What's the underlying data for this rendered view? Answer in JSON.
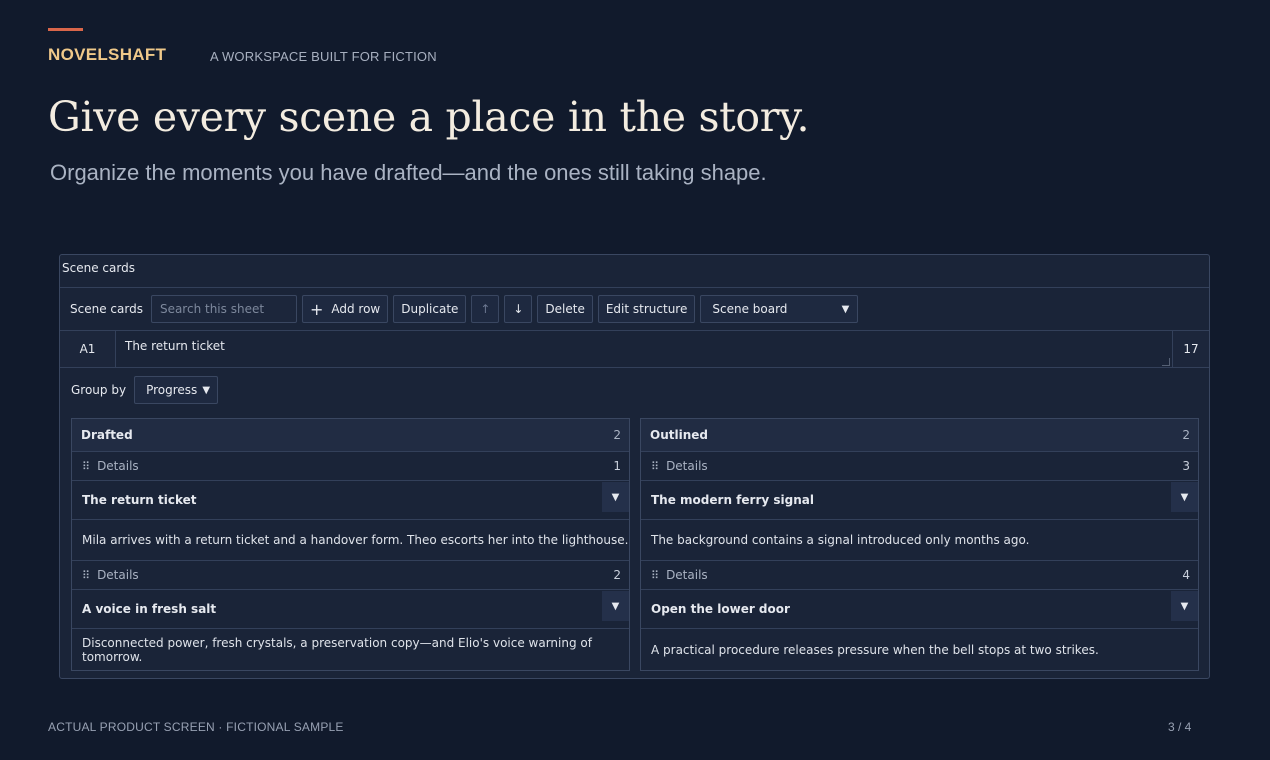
{
  "header": {
    "brand": "NOVELSHAFT",
    "tagline": "A WORKSPACE BUILT FOR FICTION",
    "headline": "Give every scene a place in the story.",
    "subhead": "Organize the moments you have drafted—and the ones still taking shape."
  },
  "panel": {
    "title": "Scene cards",
    "toolbar": {
      "label": "Scene cards",
      "search_placeholder": "Search this sheet",
      "add_row": "Add row",
      "add_icon": "+",
      "duplicate": "Duplicate",
      "move_up_icon": "↑",
      "move_down_icon": "↓",
      "delete": "Delete",
      "edit_structure": "Edit structure",
      "view_select": "Scene board"
    },
    "formula": {
      "cell_ref": "A1",
      "value": "The return ticket",
      "char_count": "17"
    },
    "group_by": {
      "label": "Group by",
      "value": "Progress"
    },
    "columns": [
      {
        "title": "Drafted",
        "count": "2",
        "cards": [
          {
            "meta": "Details",
            "number": "1",
            "title": "The return ticket",
            "body": "Mila arrives with a return ticket and a handover form. Theo escorts her into the lighthouse."
          },
          {
            "meta": "Details",
            "number": "2",
            "title": "A voice in fresh salt",
            "body": "Disconnected power, fresh crystals, a preservation copy—and Elio's voice warning of tomorrow."
          }
        ]
      },
      {
        "title": "Outlined",
        "count": "2",
        "cards": [
          {
            "meta": "Details",
            "number": "3",
            "title": "The modern ferry signal",
            "body": "The background contains a signal introduced only months ago."
          },
          {
            "meta": "Details",
            "number": "4",
            "title": "Open the lower door",
            "body": "A practical procedure releases pressure when the bell stops at two strikes."
          }
        ]
      }
    ]
  },
  "footer": {
    "left": "ACTUAL PRODUCT SCREEN · FICTIONAL SAMPLE",
    "right": "3 / 4"
  },
  "icons": {
    "chevron": "chevron-down-icon",
    "grip": "drag-handle-icon"
  },
  "colors": {
    "background": "#111a2c",
    "accent": "#d9664a",
    "brand": "#f0c98a"
  }
}
